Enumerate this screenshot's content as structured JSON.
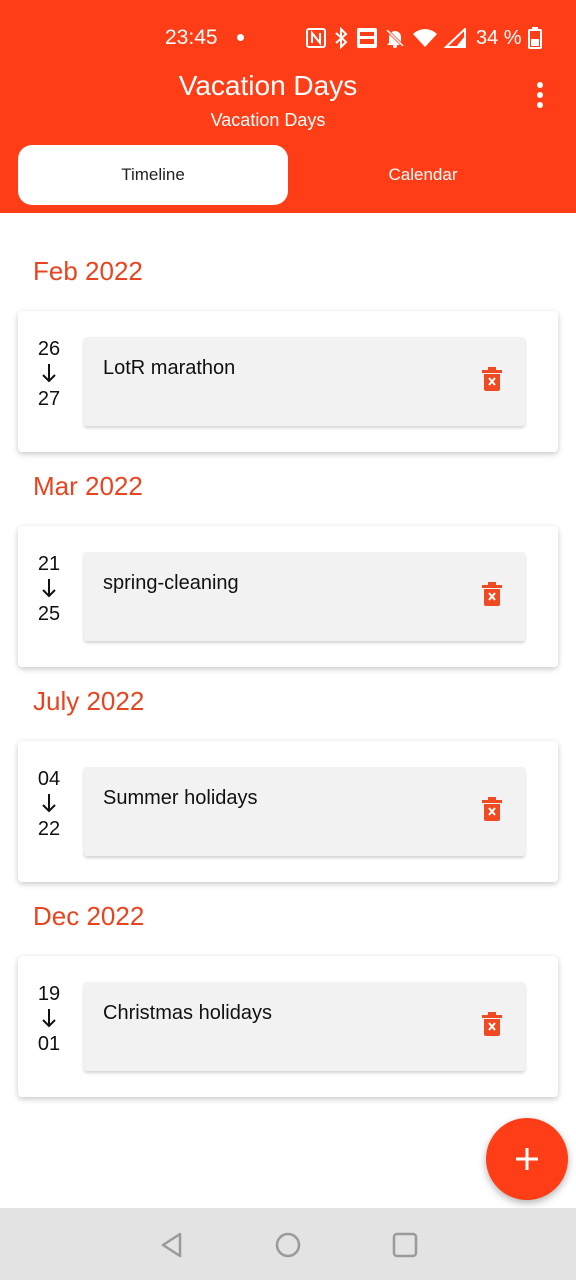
{
  "status_bar": {
    "time": "23:45",
    "battery": "34 %",
    "icons": [
      "nfc-icon",
      "bluetooth-icon",
      "volte-icon",
      "mute-icon",
      "wifi-icon",
      "signal-icon",
      "battery-icon"
    ]
  },
  "app_bar": {
    "title": "Vacation Days",
    "subtitle": "Vacation Days",
    "menu_icon": "more-vert-icon"
  },
  "tabs": [
    {
      "label": "Timeline",
      "selected": true
    },
    {
      "label": "Calendar",
      "selected": false
    }
  ],
  "groups": [
    {
      "month": "Feb 2022",
      "start": "26",
      "end": "27",
      "title": "LotR marathon"
    },
    {
      "month": "Mar 2022",
      "start": "21",
      "end": "25",
      "title": "spring-cleaning"
    },
    {
      "month": "July 2022",
      "start": "04",
      "end": "22",
      "title": "Summer holidays"
    },
    {
      "month": "Dec 2022",
      "start": "19",
      "end": "01",
      "title": "Christmas holidays"
    }
  ],
  "fab": {
    "icon": "plus-icon"
  },
  "nav": [
    "back-icon",
    "home-icon",
    "recents-icon"
  ],
  "colors": {
    "accent": "#FF3D16",
    "month_text": "#E8441F",
    "entry_bg": "#F2F2F2",
    "nav_bg": "#E3E3E3"
  }
}
